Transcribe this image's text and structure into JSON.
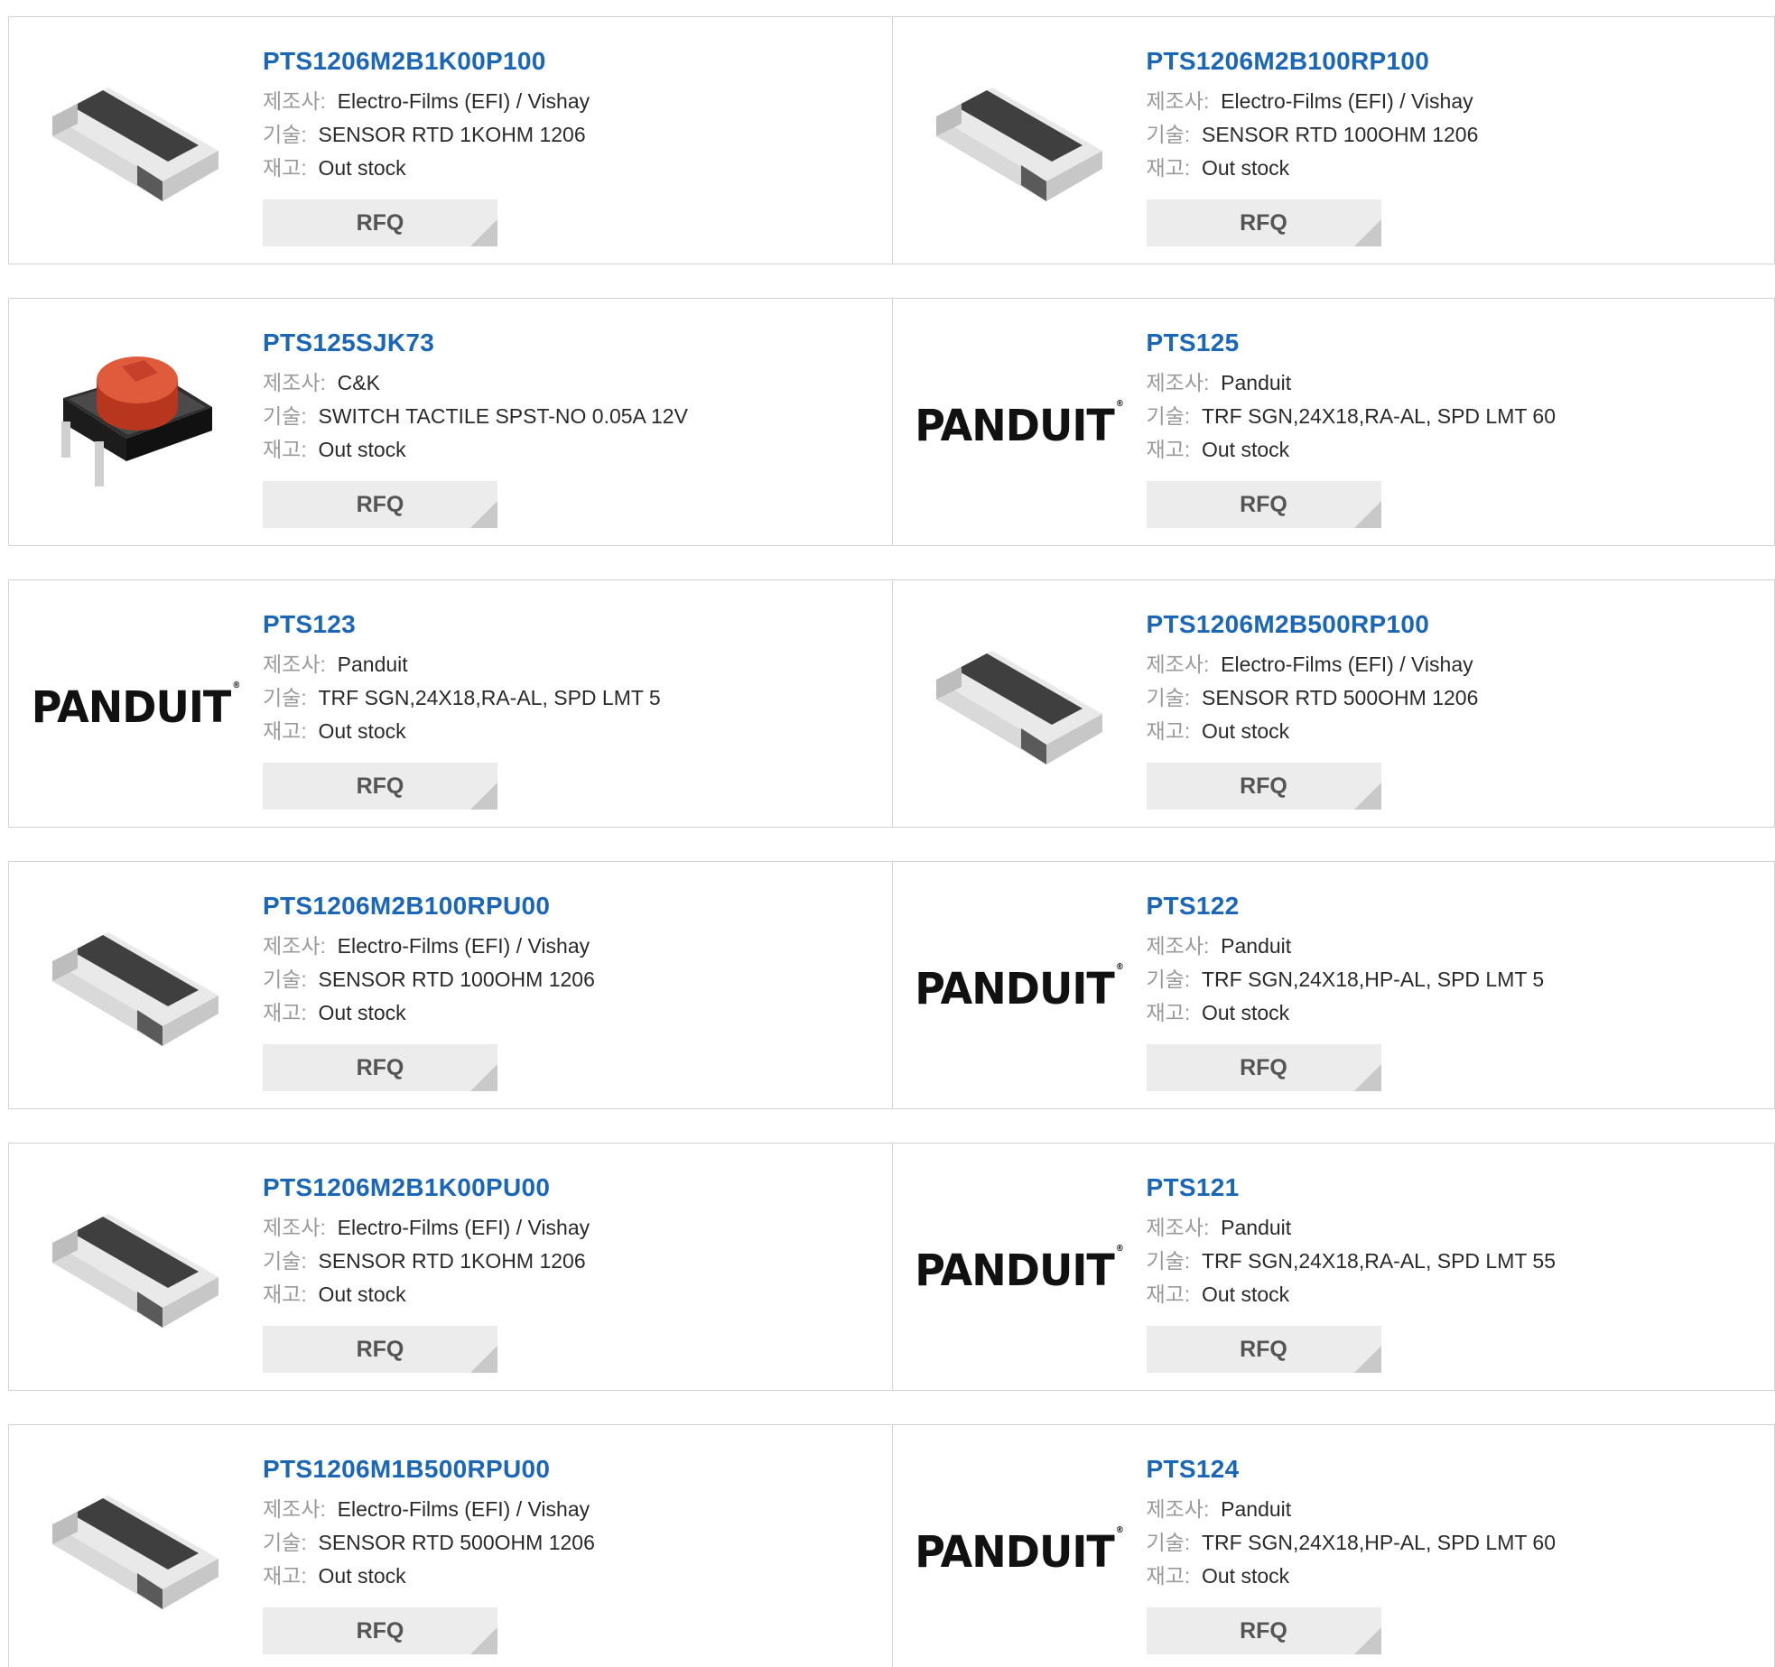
{
  "labels": {
    "maker": "제조사:",
    "desc": "기술:",
    "stock": "재고:",
    "rfq": "RFQ"
  },
  "brand_logo_text": "PANDUIT",
  "products": [
    {
      "pn": "PTS1206M2B1K00P100",
      "maker": "Electro-Films (EFI) / Vishay",
      "desc": "SENSOR RTD 1KOHM 1206",
      "stock": "Out stock",
      "image": "chip-resistor-icon"
    },
    {
      "pn": "PTS1206M2B100RP100",
      "maker": "Electro-Films (EFI) / Vishay",
      "desc": "SENSOR RTD 100OHM 1206",
      "stock": "Out stock",
      "image": "chip-resistor-icon"
    },
    {
      "pn": "PTS125SJK73",
      "maker": "C&K",
      "desc": "SWITCH TACTILE SPST-NO 0.05A 12V",
      "stock": "Out stock",
      "image": "tactile-switch-icon"
    },
    {
      "pn": "PTS125",
      "maker": "Panduit",
      "desc": "TRF SGN,24X18,RA-AL, SPD LMT 60",
      "stock": "Out stock",
      "image": "panduit-logo"
    },
    {
      "pn": "PTS123",
      "maker": "Panduit",
      "desc": "TRF SGN,24X18,RA-AL, SPD LMT 5",
      "stock": "Out stock",
      "image": "panduit-logo"
    },
    {
      "pn": "PTS1206M2B500RP100",
      "maker": "Electro-Films (EFI) / Vishay",
      "desc": "SENSOR RTD 500OHM 1206",
      "stock": "Out stock",
      "image": "chip-resistor-icon"
    },
    {
      "pn": "PTS1206M2B100RPU00",
      "maker": "Electro-Films (EFI) / Vishay",
      "desc": "SENSOR RTD 100OHM 1206",
      "stock": "Out stock",
      "image": "chip-resistor-icon"
    },
    {
      "pn": "PTS122",
      "maker": "Panduit",
      "desc": "TRF SGN,24X18,HP-AL, SPD LMT 5",
      "stock": "Out stock",
      "image": "panduit-logo"
    },
    {
      "pn": "PTS1206M2B1K00PU00",
      "maker": "Electro-Films (EFI) / Vishay",
      "desc": "SENSOR RTD 1KOHM 1206",
      "stock": "Out stock",
      "image": "chip-resistor-icon"
    },
    {
      "pn": "PTS121",
      "maker": "Panduit",
      "desc": "TRF SGN,24X18,RA-AL, SPD LMT 55",
      "stock": "Out stock",
      "image": "panduit-logo"
    },
    {
      "pn": "PTS1206M1B500RPU00",
      "maker": "Electro-Films (EFI) / Vishay",
      "desc": "SENSOR RTD 500OHM 1206",
      "stock": "Out stock",
      "image": "chip-resistor-icon"
    },
    {
      "pn": "PTS124",
      "maker": "Panduit",
      "desc": "TRF SGN,24X18,HP-AL, SPD LMT 60",
      "stock": "Out stock",
      "image": "panduit-logo"
    }
  ]
}
